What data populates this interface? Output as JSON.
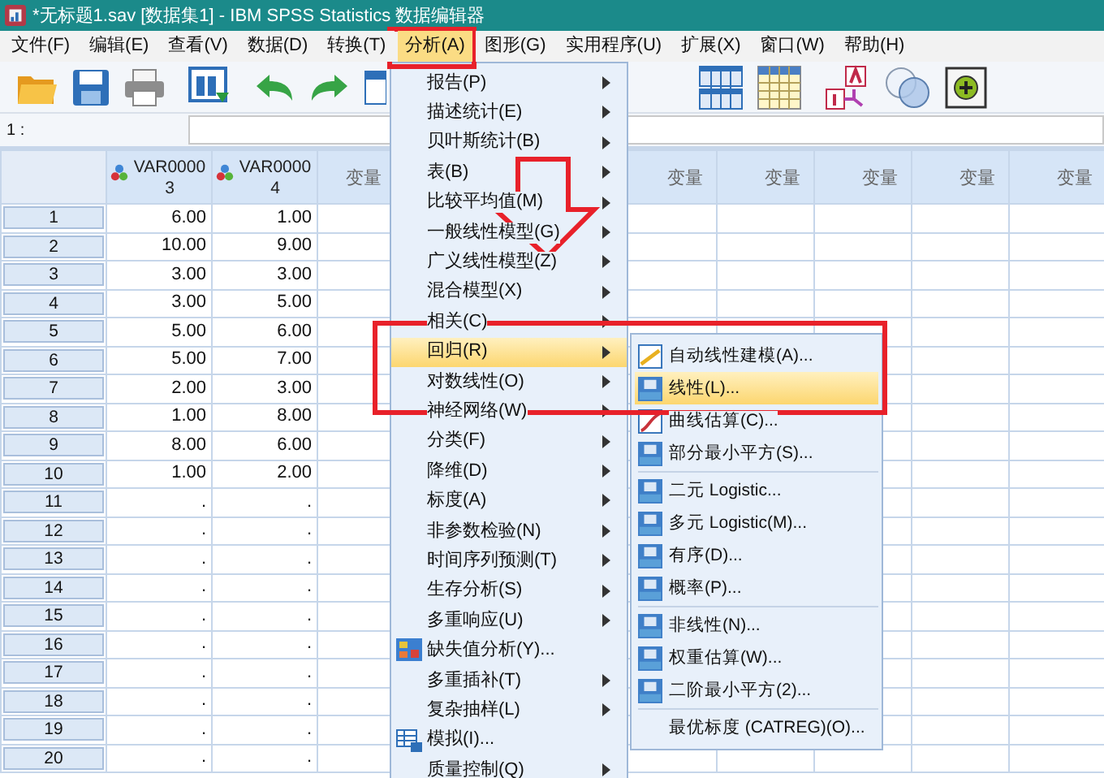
{
  "window": {
    "title": "*无标题1.sav [数据集1] - IBM SPSS Statistics 数据编辑器"
  },
  "menu_bar": [
    {
      "label": "文件(F)",
      "selected": false
    },
    {
      "label": "编辑(E)",
      "selected": false
    },
    {
      "label": "查看(V)",
      "selected": false
    },
    {
      "label": "数据(D)",
      "selected": false
    },
    {
      "label": "转换(T)",
      "selected": false
    },
    {
      "label": "分析(A)",
      "selected": true
    },
    {
      "label": "图形(G)",
      "selected": false
    },
    {
      "label": "实用程序(U)",
      "selected": false
    },
    {
      "label": "扩展(X)",
      "selected": false
    },
    {
      "label": "窗口(W)",
      "selected": false
    },
    {
      "label": "帮助(H)",
      "selected": false
    }
  ],
  "cell_editor": {
    "label": "1 :"
  },
  "grid": {
    "variables": [
      {
        "name": "VAR00003"
      },
      {
        "name": "VAR00004"
      }
    ],
    "empty_columns_left": [
      {
        "label": "变量"
      }
    ],
    "empty_columns_right": [
      {
        "label": "变量"
      },
      {
        "label": "变量"
      },
      {
        "label": "变量"
      },
      {
        "label": "变量"
      },
      {
        "label": "变量"
      }
    ],
    "rows": [
      {
        "header": "1",
        "cells": [
          "6.00",
          "1.00"
        ]
      },
      {
        "header": "2",
        "cells": [
          "10.00",
          "9.00"
        ]
      },
      {
        "header": "3",
        "cells": [
          "3.00",
          "3.00"
        ]
      },
      {
        "header": "4",
        "cells": [
          "3.00",
          "5.00"
        ]
      },
      {
        "header": "5",
        "cells": [
          "5.00",
          "6.00"
        ]
      },
      {
        "header": "6",
        "cells": [
          "5.00",
          "7.00"
        ]
      },
      {
        "header": "7",
        "cells": [
          "2.00",
          "3.00"
        ]
      },
      {
        "header": "8",
        "cells": [
          "1.00",
          "8.00"
        ]
      },
      {
        "header": "9",
        "cells": [
          "8.00",
          "6.00"
        ]
      },
      {
        "header": "10",
        "cells": [
          "1.00",
          "2.00"
        ]
      },
      {
        "header": "11",
        "cells": [
          ".",
          "."
        ]
      },
      {
        "header": "12",
        "cells": [
          ".",
          "."
        ]
      },
      {
        "header": "13",
        "cells": [
          ".",
          "."
        ]
      },
      {
        "header": "14",
        "cells": [
          ".",
          "."
        ]
      },
      {
        "header": "15",
        "cells": [
          ".",
          "."
        ]
      },
      {
        "header": "16",
        "cells": [
          ".",
          "."
        ]
      },
      {
        "header": "17",
        "cells": [
          ".",
          "."
        ]
      },
      {
        "header": "18",
        "cells": [
          ".",
          "."
        ]
      },
      {
        "header": "19",
        "cells": [
          ".",
          "."
        ]
      },
      {
        "header": "20",
        "cells": [
          ".",
          "."
        ]
      }
    ]
  },
  "analyze_menu": [
    {
      "label": "报告(P)",
      "kind": "submenu",
      "selected": false
    },
    {
      "label": "描述统计(E)",
      "kind": "submenu",
      "selected": false
    },
    {
      "label": "贝叶斯统计(B)",
      "kind": "submenu",
      "selected": false
    },
    {
      "label": "表(B)",
      "kind": "submenu",
      "selected": false
    },
    {
      "label": "比较平均值(M)",
      "kind": "submenu",
      "selected": false
    },
    {
      "label": "一般线性模型(G)",
      "kind": "submenu",
      "selected": false
    },
    {
      "label": "广义线性模型(Z)",
      "kind": "submenu",
      "selected": false
    },
    {
      "label": "混合模型(X)",
      "kind": "submenu",
      "selected": false
    },
    {
      "label": "相关(C)",
      "kind": "submenu",
      "selected": false
    },
    {
      "label": "回归(R)",
      "kind": "submenu",
      "selected": true
    },
    {
      "label": "对数线性(O)",
      "kind": "submenu",
      "selected": false
    },
    {
      "label": "神经网络(W)",
      "kind": "submenu",
      "selected": false
    },
    {
      "label": "分类(F)",
      "kind": "submenu",
      "selected": false
    },
    {
      "label": "降维(D)",
      "kind": "submenu",
      "selected": false
    },
    {
      "label": "标度(A)",
      "kind": "submenu",
      "selected": false
    },
    {
      "label": "非参数检验(N)",
      "kind": "submenu",
      "selected": false
    },
    {
      "label": "时间序列预测(T)",
      "kind": "submenu",
      "selected": false
    },
    {
      "label": "生存分析(S)",
      "kind": "submenu",
      "selected": false
    },
    {
      "label": "多重响应(U)",
      "kind": "submenu",
      "selected": false
    },
    {
      "label": "缺失值分析(Y)...",
      "kind": "missing",
      "selected": false
    },
    {
      "label": "多重插补(T)",
      "kind": "submenu",
      "selected": false
    },
    {
      "label": "复杂抽样(L)",
      "kind": "submenu",
      "selected": false
    },
    {
      "label": "模拟(I)...",
      "kind": "simulation",
      "selected": false
    },
    {
      "label": "质量控制(Q)",
      "kind": "submenu",
      "selected": false
    }
  ],
  "regression_submenu": [
    {
      "label": "自动线性建模(A)...",
      "kind": "automatic",
      "selected": false,
      "separator_after": false
    },
    {
      "label": "线性(L)...",
      "kind": "procedure",
      "selected": true,
      "separator_after": false
    },
    {
      "label": "曲线估算(C)...",
      "kind": "curve",
      "selected": false,
      "separator_after": false
    },
    {
      "label": "部分最小平方(S)...",
      "kind": "procedure",
      "selected": false,
      "separator_after": true
    },
    {
      "label": "二元 Logistic...",
      "kind": "procedure",
      "selected": false,
      "separator_after": false
    },
    {
      "label": "多元 Logistic(M)...",
      "kind": "procedure",
      "selected": false,
      "separator_after": false
    },
    {
      "label": "有序(D)...",
      "kind": "procedure",
      "selected": false,
      "separator_after": false
    },
    {
      "label": "概率(P)...",
      "kind": "procedure",
      "selected": false,
      "separator_after": true
    },
    {
      "label": "非线性(N)...",
      "kind": "procedure",
      "selected": false,
      "separator_after": false
    },
    {
      "label": "权重估算(W)...",
      "kind": "procedure",
      "selected": false,
      "separator_after": false
    },
    {
      "label": "二阶最小平方(2)...",
      "kind": "procedure",
      "selected": false,
      "separator_after": true
    },
    {
      "label": "最优标度 (CATREG)(O)...",
      "kind": "plain",
      "selected": false,
      "separator_after": false
    }
  ]
}
